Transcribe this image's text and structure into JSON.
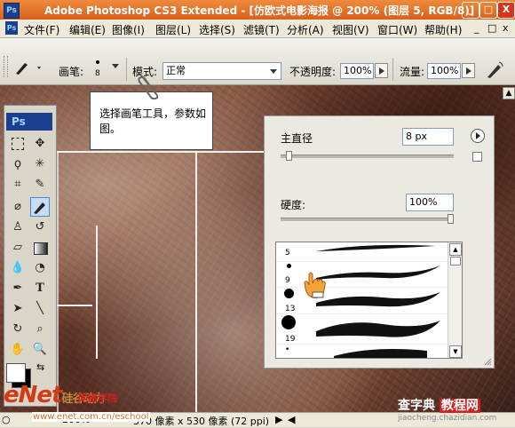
{
  "window": {
    "title": "Adobe Photoshop CS3 Extended - [仿欧式电影海报 @ 200% (图层 5, RGB/8)]",
    "app_badge": "Ps",
    "minimize": "_",
    "maximize": "□",
    "close": "X"
  },
  "menu": {
    "doc_badge": "Ps",
    "items": [
      "文件(F)",
      "编辑(E)",
      "图像(I)",
      "图层(L)",
      "选择(S)",
      "滤镜(T)",
      "分析(A)",
      "视图(V)",
      "窗口(W)",
      "帮助(H)"
    ],
    "doc_min": "_",
    "doc_max": "□",
    "doc_close": "x"
  },
  "options": {
    "brush_label": "画笔:",
    "brush_size": "8",
    "mode_label": "模式:",
    "mode_value": "正常",
    "opacity_label": "不透明度:",
    "opacity_value": "100%",
    "flow_label": "流量:",
    "flow_value": "100%"
  },
  "toolbox": {
    "badge": "Ps"
  },
  "callout": {
    "text": "选择画笔工具，参数如图。"
  },
  "brush_panel": {
    "master_diameter_label": "主直径",
    "master_diameter_value": "8 px",
    "master_diameter_fraction": 0.03,
    "hardness_label": "硬度:",
    "hardness_value": "100%",
    "hardness_fraction": 1.0,
    "presets": [
      "5",
      "9",
      "13",
      "19",
      "•"
    ],
    "menu_icon": "right-arrow-icon"
  },
  "statusbar": {
    "zoom": "200%",
    "doc_info": "370 像素 x 530 像素 (72 ppi)"
  },
  "watermarks": {
    "enet": "eNet",
    "enet_suffix": "硅谷动力",
    "enet_cn": "网络学院",
    "enet_url": "www.enet.com.cn/eschool",
    "chazidian": "查字典",
    "chazidian_tag": "教程网",
    "chazidian_url": "jiaocheng.chazidian.com"
  }
}
